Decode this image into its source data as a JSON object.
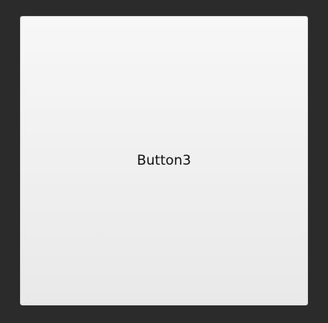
{
  "button": {
    "label": "Button3"
  }
}
